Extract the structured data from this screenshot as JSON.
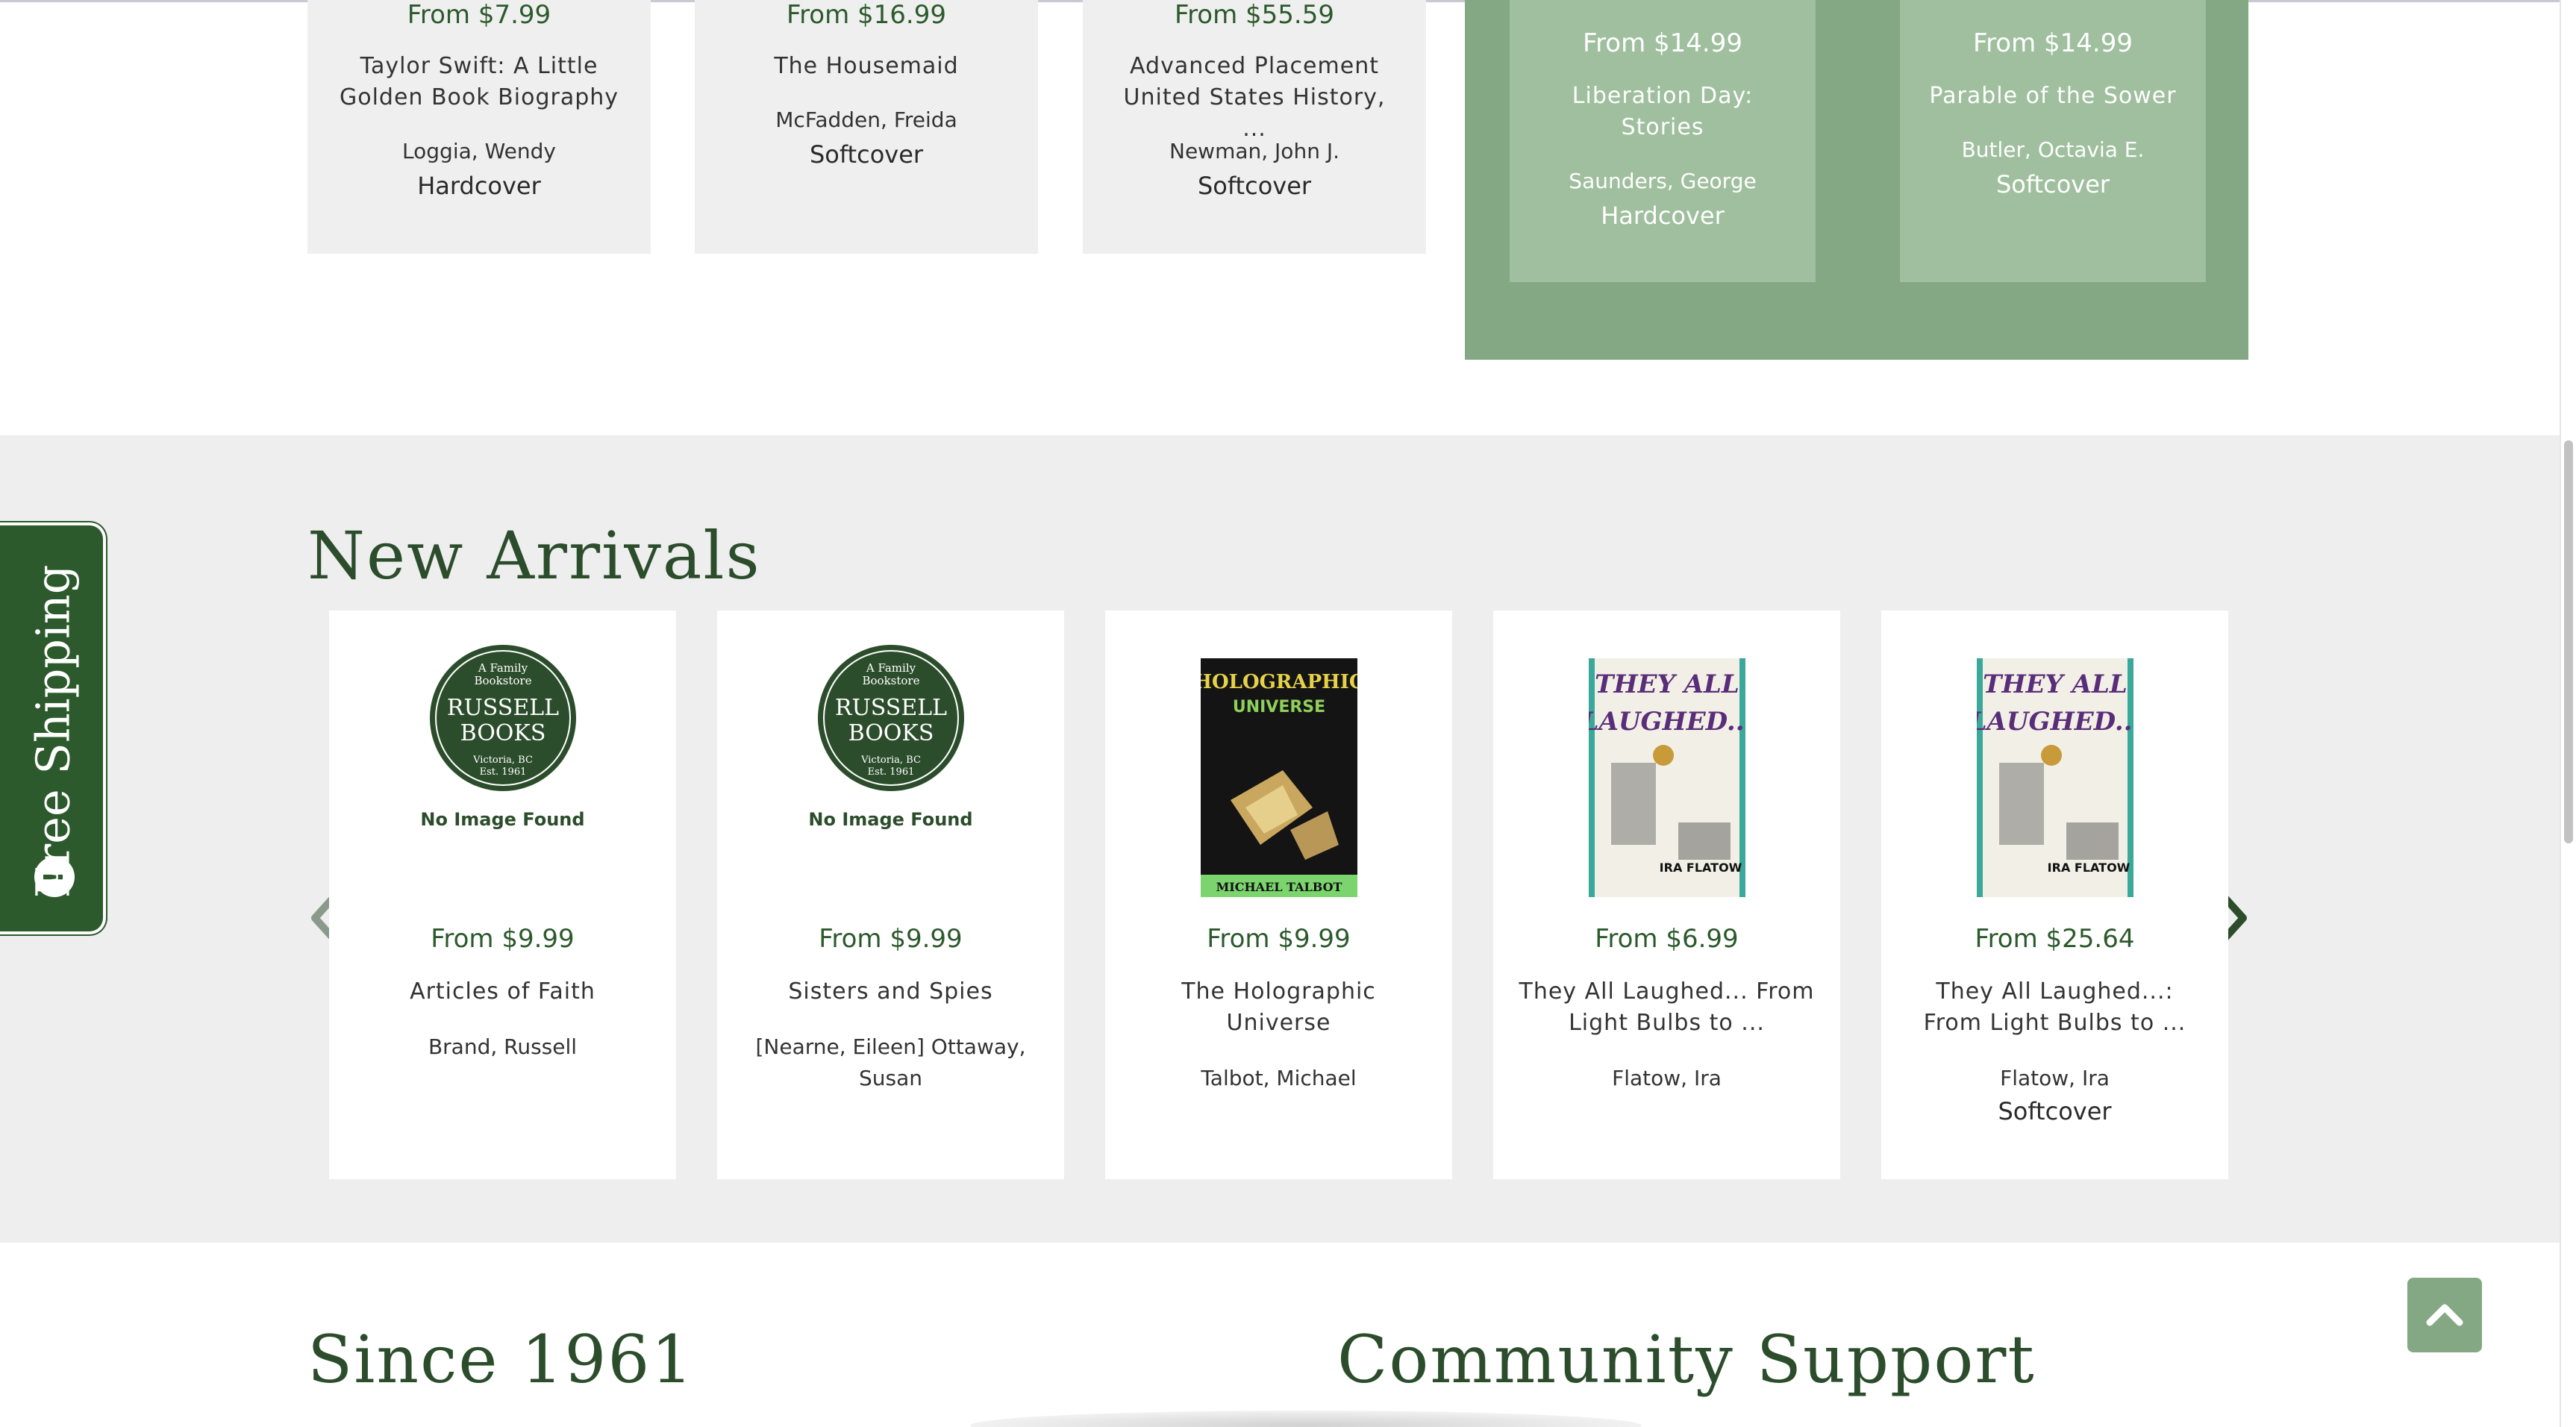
{
  "top_cards": [
    {
      "price": "From $7.99",
      "title": "Taylor Swift: A Little Golden Book Biography",
      "author": "Loggia, Wendy",
      "format": "Hardcover"
    },
    {
      "price": "From $16.99",
      "title": "The Housemaid",
      "author": "McFadden, Freida",
      "format": "Softcover"
    },
    {
      "price": "From $55.59",
      "title": "Advanced Placement United States History, ...",
      "author": "Newman, John J.",
      "format": "Softcover"
    }
  ],
  "green_cards": [
    {
      "price": "From $14.99",
      "title": "Liberation Day: Stories",
      "author": "Saunders, George",
      "format": "Hardcover"
    },
    {
      "price": "From $14.99",
      "title": "Parable of the Sower",
      "author": "Butler, Octavia E.",
      "format": "Softcover"
    }
  ],
  "free_shipping": {
    "label": "Free Shipping",
    "icon_text": "!"
  },
  "new_arrivals": {
    "title": "New Arrivals",
    "books": [
      {
        "price": "From $9.99",
        "title": "Articles of Faith",
        "author": "Brand, Russell",
        "format": "",
        "cover": "placeholder",
        "no_image": "No Image Found"
      },
      {
        "price": "From $9.99",
        "title": "Sisters and Spies",
        "author": "[Nearne, Eileen] Ottaway, Susan",
        "format": "",
        "cover": "placeholder",
        "no_image": "No Image Found"
      },
      {
        "price": "From $9.99",
        "title": "The Holographic Universe",
        "author": "Talbot, Michael",
        "format": "",
        "cover": "holographic"
      },
      {
        "price": "From $6.99",
        "title": "They All Laughed... From Light Bulbs to ...",
        "author": "Flatow, Ira",
        "format": "",
        "cover": "laughed"
      },
      {
        "price": "From $25.64",
        "title": "They All Laughed...: From Light Bulbs to ...",
        "author": "Flatow, Ira",
        "format": "Softcover",
        "cover": "laughed"
      }
    ]
  },
  "logo": {
    "line1": "A Family",
    "line2": "Bookstore",
    "name1": "RUSSELL",
    "name2": "BOOKS",
    "place": "Victoria, BC",
    "est": "Est. 1961"
  },
  "covers": {
    "holographic": {
      "title1": "HOLOGRAPHIC",
      "title2": "UNIVERSE",
      "author": "MICHAEL TALBOT"
    },
    "laughed": {
      "title1": "THEY ALL",
      "title2": "LAUGHED...",
      "author": "IRA FLATOW"
    }
  },
  "bottom": {
    "since": "Since 1961",
    "community": "Community Support"
  },
  "colors": {
    "brand_green": "#2c5a2c",
    "sage": "#84a883",
    "heading": "#2c4d2c"
  }
}
